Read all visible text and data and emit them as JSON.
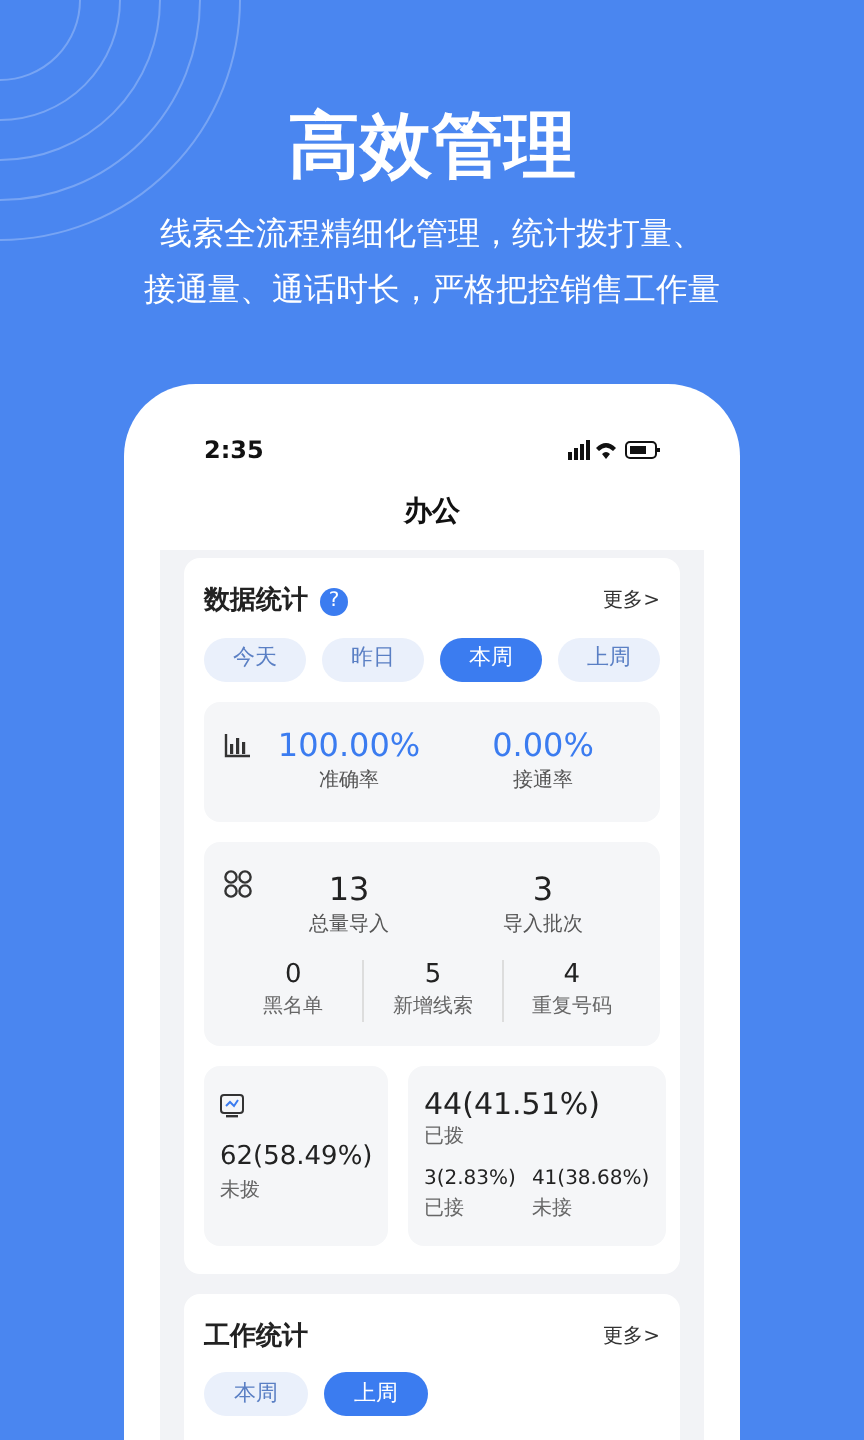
{
  "headline": "高效管理",
  "subtitle_lines": [
    "线索全流程精细化管理，统计拨打量、",
    "接通量、通话时长，严格把控销售工作量"
  ],
  "status_bar": {
    "time": "2:35"
  },
  "page_title": "办公",
  "data_card": {
    "title": "数据统计",
    "help": "?",
    "more": "更多>",
    "tabs": [
      {
        "label": "今天",
        "selected": false
      },
      {
        "label": "昨日",
        "selected": false
      },
      {
        "label": "本周",
        "selected": true
      },
      {
        "label": "上周",
        "selected": false
      }
    ],
    "rates": [
      {
        "value": "100.00%",
        "label": "准确率"
      },
      {
        "value": "0.00%",
        "label": "接通率"
      }
    ],
    "imports": [
      {
        "value": "13",
        "label": "总量导入"
      },
      {
        "value": "3",
        "label": "导入批次"
      }
    ],
    "details": [
      {
        "value": "0",
        "label": "黑名单"
      },
      {
        "value": "5",
        "label": "新增线索"
      },
      {
        "value": "4",
        "label": "重复号码"
      }
    ],
    "not_dialed": {
      "value": "62(58.49%)",
      "label": "未拨"
    },
    "dialed": {
      "value": "44(41.51%)",
      "label": "已拨",
      "parts": [
        {
          "value": "3(2.83%)",
          "label": "已接"
        },
        {
          "value": "41(38.68%)",
          "label": "未接"
        }
      ]
    }
  },
  "work_card": {
    "title": "工作统计",
    "more": "更多>",
    "tabs": [
      {
        "label": "本周",
        "selected": false
      },
      {
        "label": "上周",
        "selected": true
      }
    ]
  }
}
